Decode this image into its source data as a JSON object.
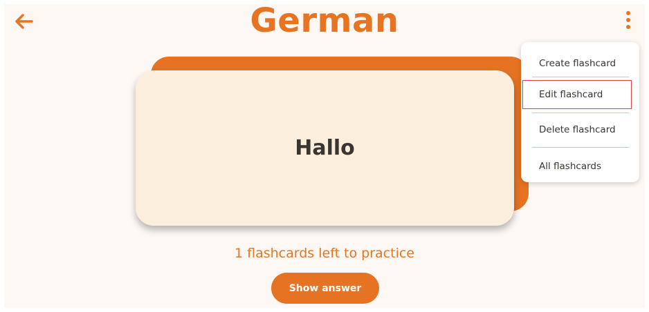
{
  "header": {
    "title": "German",
    "back_icon": "arrow-left-icon",
    "menu_icon": "more-vertical-icon"
  },
  "card": {
    "word": "Hallo"
  },
  "status": {
    "remaining_text": "1 flashcards left to practice"
  },
  "actions": {
    "show_answer_label": "Show answer"
  },
  "menu": {
    "items": [
      {
        "label": "Create flashcard"
      },
      {
        "label": "Edit flashcard",
        "highlighted": true
      },
      {
        "label": "Delete flashcard"
      },
      {
        "label": "All flashcards"
      }
    ]
  },
  "colors": {
    "accent": "#e67423",
    "card_front": "#fbeedd",
    "background": "#fdf8f3",
    "highlight_border": "#e0424a"
  }
}
